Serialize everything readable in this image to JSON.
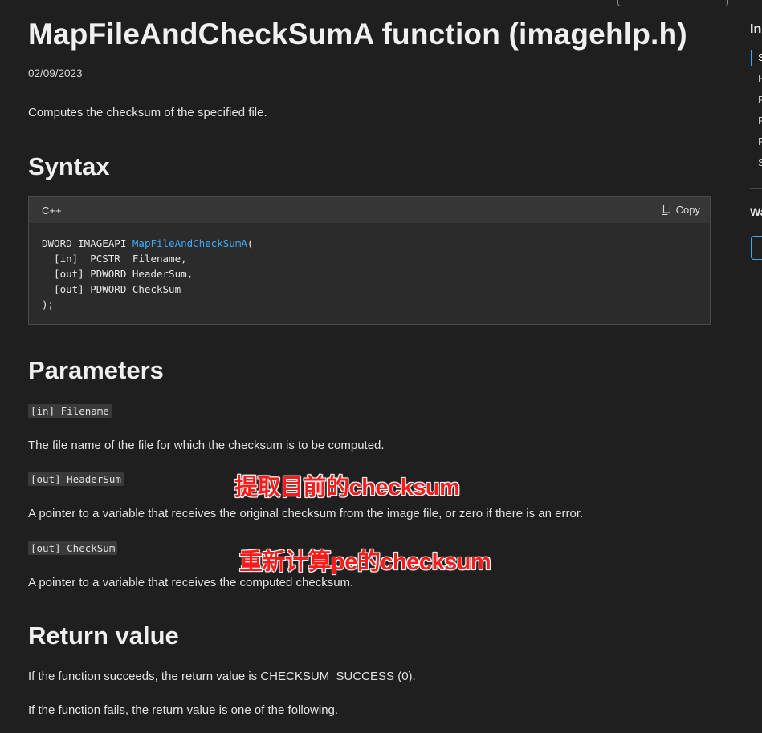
{
  "page": {
    "title": "MapFileAndCheckSumA function (imagehlp.h)",
    "date": "02/09/2023",
    "description": "Computes the checksum of the specified file."
  },
  "syntax": {
    "heading": "Syntax",
    "language": "C++",
    "copy_label": "Copy",
    "code": {
      "line1_prefix": "DWORD IMAGEAPI ",
      "function_name": "MapFileAndCheckSumA",
      "line1_suffix": "(",
      "line2": "  [in]  PCSTR  Filename,",
      "line3": "  [out] PDWORD HeaderSum,",
      "line4": "  [out] PDWORD CheckSum",
      "line5": ");"
    }
  },
  "parameters": {
    "heading": "Parameters",
    "items": [
      {
        "tag": "[in] Filename",
        "description": "The file name of the file for which the checksum is to be computed."
      },
      {
        "tag": "[out] HeaderSum",
        "description": "A pointer to a variable that receives the original checksum from the image file, or zero if there is an error."
      },
      {
        "tag": "[out] CheckSum",
        "description": "A pointer to a variable that receives the computed checksum."
      }
    ]
  },
  "annotations": {
    "headersum_note": "提取目前的checksum",
    "checksum_note": "重新计算pe的checksum"
  },
  "return_value": {
    "heading": "Return value",
    "para1": "If the function succeeds, the return value is CHECKSUM_SUCCESS (0).",
    "para2": "If the function fails, the return value is one of the following."
  },
  "sidebar": {
    "title": "In",
    "items": [
      "S",
      "P",
      "P",
      "P",
      "P",
      "S"
    ],
    "section2_title": "Wa"
  },
  "colors": {
    "background": "#1f1f1f",
    "link": "#3fa9f5",
    "annotation": "#ff1a1a"
  }
}
